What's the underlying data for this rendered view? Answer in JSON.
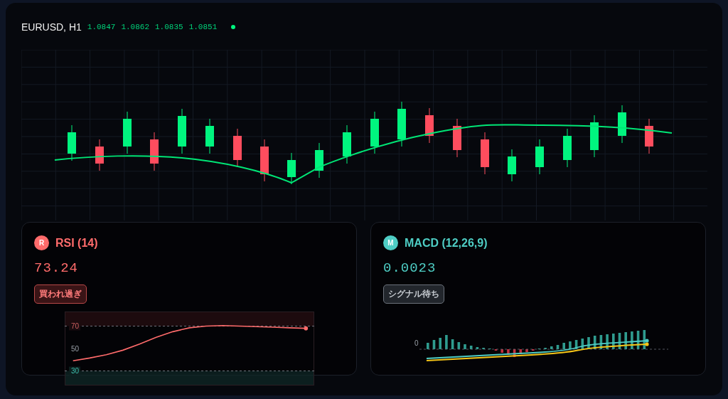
{
  "header": {
    "symbol": "EURUSD, H1",
    "ohlc": [
      "1.0847",
      "1.0862",
      "1.0835",
      "1.0851"
    ],
    "live": true
  },
  "panels": [
    {
      "kind": "rsi",
      "color": "#ff6b6b",
      "icon_letter": "R",
      "title": "RSI (14)",
      "value": "73.24",
      "badge": {
        "label": "買われ過ぎ",
        "kind": "alert"
      },
      "chart_data": {
        "type": "line",
        "ylim": [
          17,
          83
        ],
        "yticks": [
          70,
          50,
          30
        ],
        "series": [
          {
            "color": "#ff6b6b",
            "values": [
              39,
              41.5,
              44.5,
              48.5,
              54,
              60,
              65,
              68.5,
              70,
              70.5,
              70,
              69.5,
              69,
              68.5,
              68
            ]
          }
        ]
      }
    },
    {
      "kind": "macd",
      "color": "#4ecdc4",
      "icon_letter": "M",
      "title": "MACD (12,26,9)",
      "value": "0.0023",
      "badge": {
        "label": "シグナル待ち",
        "kind": "neutral"
      },
      "zero_label": "0"
    }
  ]
}
